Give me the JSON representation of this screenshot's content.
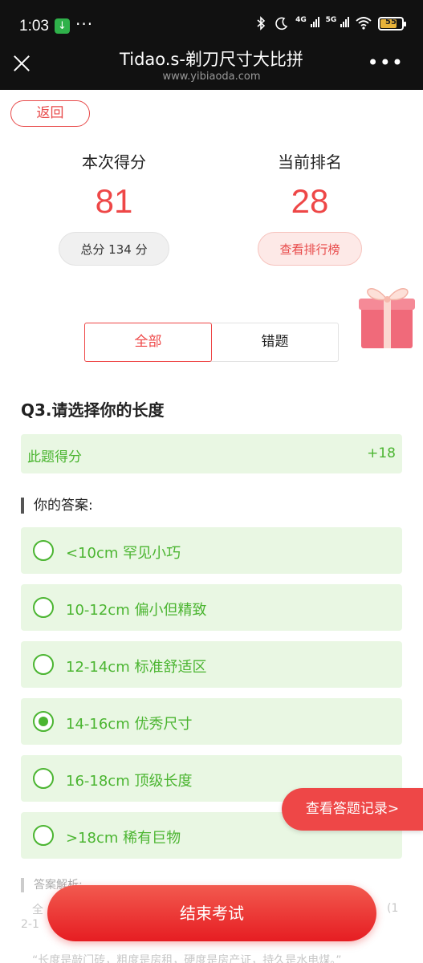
{
  "status_bar": {
    "time": "1:03",
    "network_4g": "4G",
    "network_5g": "5G",
    "battery_level": "55"
  },
  "nav": {
    "title": "Tidao.s-剃刀尺寸大比拼",
    "url": "www.yibiaoda.com"
  },
  "back_label": "返回",
  "score": {
    "label": "本次得分",
    "value": "81",
    "total_label": "总分 134 分"
  },
  "rank": {
    "label": "当前排名",
    "value": "28",
    "button_label": "查看排行榜"
  },
  "tabs": [
    {
      "label": "全部",
      "active": true
    },
    {
      "label": "错题",
      "active": false
    }
  ],
  "question": {
    "title": "Q3.请选择你的长度",
    "score_label": "此题得分",
    "score_value": "+18",
    "answer_heading": "你的答案:",
    "options": [
      {
        "text": "<10cm 罕见小巧",
        "checked": false
      },
      {
        "text": "10-12cm 偏小但精致",
        "checked": false
      },
      {
        "text": "12-14cm 标准舒适区",
        "checked": false
      },
      {
        "text": "14-16cm 优秀尺寸",
        "checked": true
      },
      {
        "text": "16-18cm 顶级长度",
        "checked": false
      },
      {
        "text": ">18cm 稀有巨物",
        "checked": false
      }
    ]
  },
  "analysis": {
    "heading": "答案解析:",
    "line1_start": "全",
    "line1_end": "(1",
    "line2_start": "2-1",
    "quote": "“长度是敲门砖，粗度是房租，硬度是房产证，持久是水电煤。”"
  },
  "float_button_label": "查看答题记录>",
  "end_button_label": "结束考试",
  "colors": {
    "accent_red": "#ee4747",
    "success_green": "#4bb531",
    "success_bg": "#e9f7e3"
  }
}
